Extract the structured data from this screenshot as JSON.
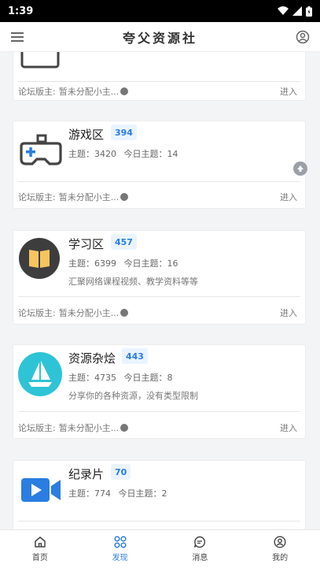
{
  "status": {
    "time": "1:39"
  },
  "header": {
    "title": "夸父资源社"
  },
  "colors": {
    "accent": "#2a7de1",
    "badge_bg": "#eaf4ff"
  },
  "forums": [
    {
      "name": "",
      "count": "",
      "topics": "",
      "today": "",
      "desc": "",
      "moderator_label": "论坛版主:",
      "moderator_value": "暂未分配小主...",
      "enter": "进入",
      "icon": "calendar-icon"
    },
    {
      "name": "游戏区",
      "count": "394",
      "topics": "主题：3420",
      "today": "今日主题：14",
      "desc": "",
      "moderator_label": "论坛版主:",
      "moderator_value": "暂未分配小主...",
      "enter": "进入",
      "icon": "gamepad-icon"
    },
    {
      "name": "学习区",
      "count": "457",
      "topics": "主题：6399",
      "today": "今日主题：16",
      "desc": "汇聚网络课程视频、教学资料等等",
      "moderator_label": "论坛版主:",
      "moderator_value": "暂未分配小主...",
      "enter": "进入",
      "icon": "book-icon"
    },
    {
      "name": "资源杂烩",
      "count": "443",
      "topics": "主题：4735",
      "today": "今日主题：8",
      "desc": "分享你的各种资源，没有类型限制",
      "moderator_label": "论坛版主:",
      "moderator_value": "暂未分配小主...",
      "enter": "进入",
      "icon": "sailboat-icon"
    },
    {
      "name": "纪录片",
      "count": "70",
      "topics": "主题：774",
      "today": "今日主题：2",
      "desc": "",
      "icon": "video-camera-icon"
    }
  ],
  "nav": [
    {
      "label": "首页",
      "icon": "home-icon"
    },
    {
      "label": "发现",
      "icon": "grid-icon"
    },
    {
      "label": "消息",
      "icon": "message-icon"
    },
    {
      "label": "我的",
      "icon": "user-icon"
    }
  ]
}
